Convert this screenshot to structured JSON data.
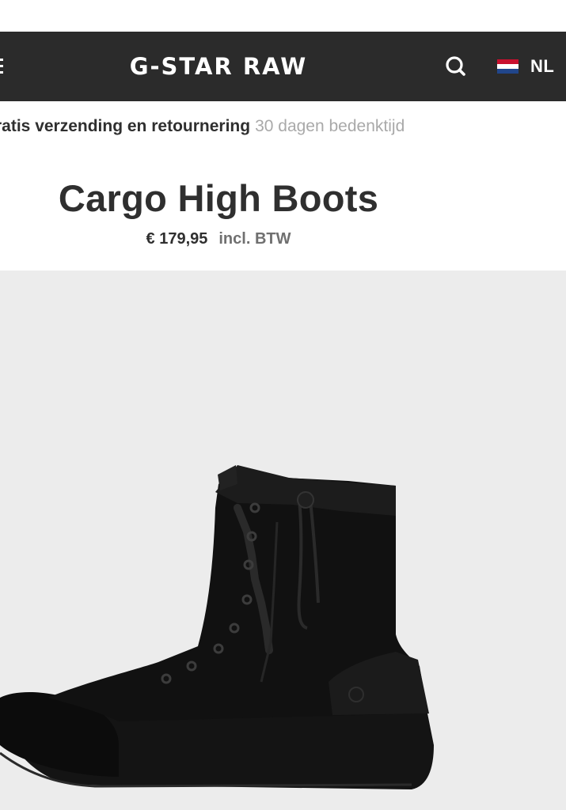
{
  "header": {
    "logo_text": "G-STAR RAW",
    "search_icon": "search-icon",
    "country_code": "NL",
    "flag_colors": [
      "#c8102e",
      "#ffffff",
      "#21468b"
    ]
  },
  "usp": {
    "strong": "ratis verzending en retournering",
    "muted": "30 dagen bedenktijd"
  },
  "product": {
    "title": "Cargo High Boots",
    "price": "€ 179,95",
    "tax_note": "incl. BTW",
    "image_icon": "boot-image"
  },
  "colors": {
    "header_bg": "#2b2b2b",
    "image_bg": "#ececec",
    "text": "#2f2f2f",
    "muted": "#a9a9a9"
  }
}
